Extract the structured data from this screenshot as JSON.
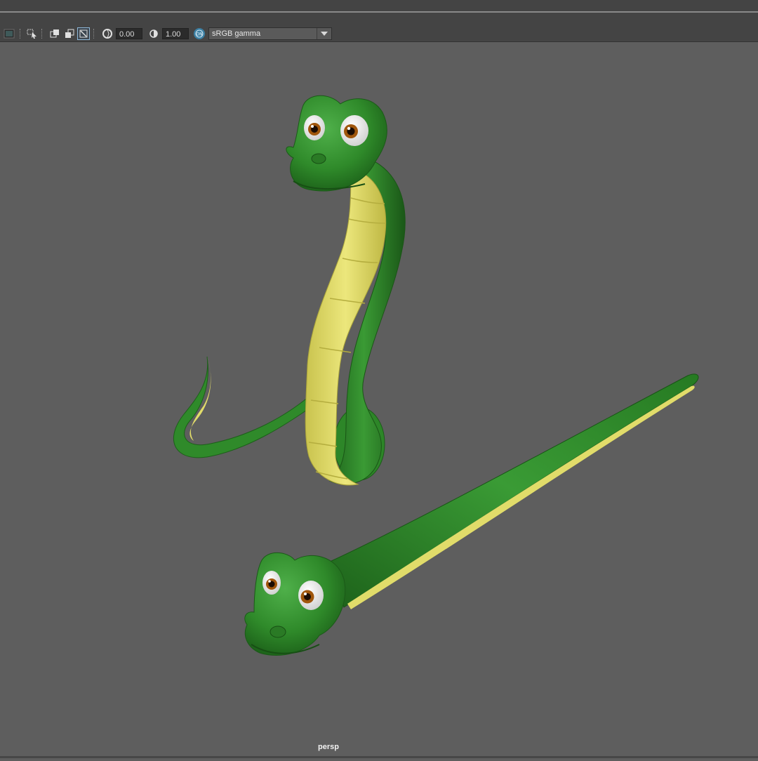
{
  "toolbar": {
    "exposure_value": "0.00",
    "gamma_value": "1.00",
    "colorspace": "sRGB gamma",
    "icons": [
      "viewport-shading-icon",
      "select-camera-icon",
      "resolution-gate-icon",
      "xray-icon",
      "isolate-select-icon",
      "exposure-icon",
      "gamma-icon",
      "color-management-icon"
    ]
  },
  "viewport": {
    "camera_name": "persp",
    "background": "#5e5e5e",
    "objects": [
      "snake-upright",
      "snake-straight"
    ]
  },
  "colors": {
    "snake_green": "#2f8a2a",
    "belly_yellow": "#e1dc6a",
    "eye_iris": "#a0560c"
  }
}
